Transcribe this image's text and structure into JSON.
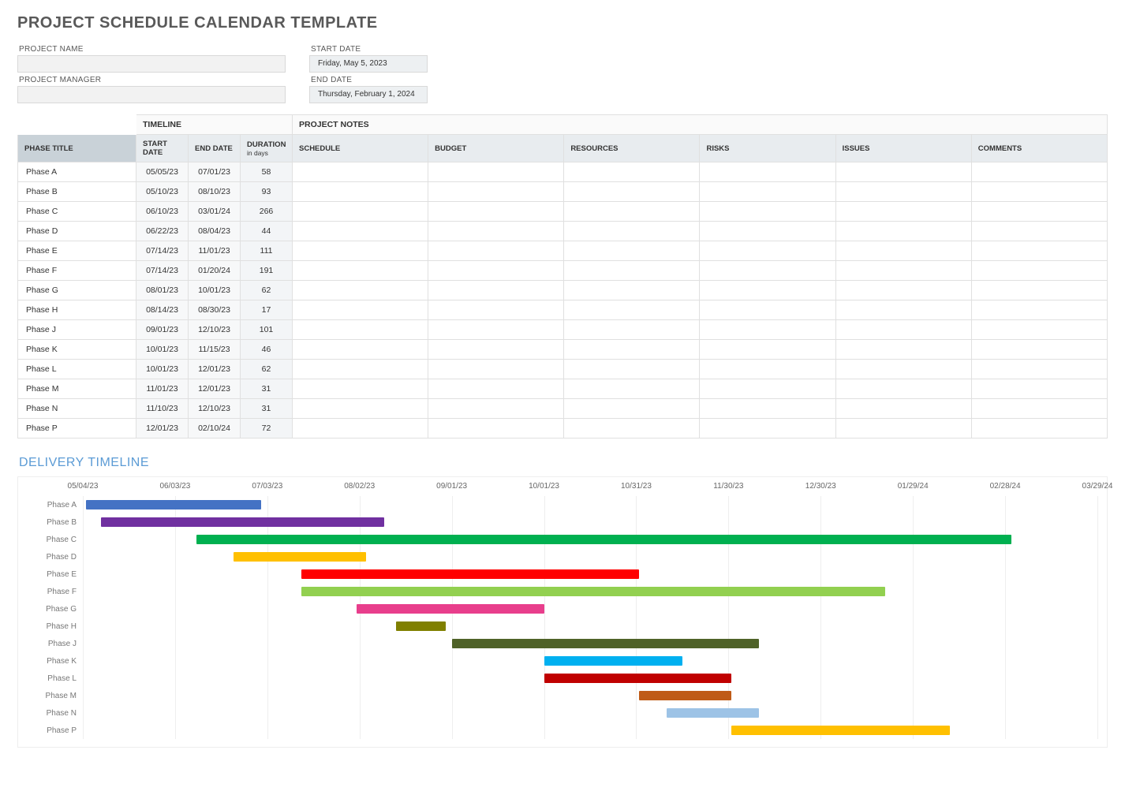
{
  "title": "PROJECT SCHEDULE CALENDAR TEMPLATE",
  "meta": {
    "project_name_label": "PROJECT NAME",
    "project_name_value": "",
    "project_manager_label": "PROJECT MANAGER",
    "project_manager_value": "",
    "start_date_label": "START DATE",
    "start_date_value": "Friday, May 5, 2023",
    "end_date_label": "END DATE",
    "end_date_value": "Thursday, February 1, 2024"
  },
  "table": {
    "group_timeline": "TIMELINE",
    "group_notes": "PROJECT NOTES",
    "headers": {
      "phase": "PHASE TITLE",
      "start": "START DATE",
      "end": "END DATE",
      "duration": "DURATION",
      "duration_sub": "in days",
      "schedule": "SCHEDULE",
      "budget": "BUDGET",
      "resources": "RESOURCES",
      "risks": "RISKS",
      "issues": "ISSUES",
      "comments": "COMMENTS"
    },
    "rows": [
      {
        "phase": "Phase A",
        "start": "05/05/23",
        "end": "07/01/23",
        "duration": "58",
        "schedule": "",
        "budget": "",
        "resources": "",
        "risks": "",
        "issues": "",
        "comments": ""
      },
      {
        "phase": "Phase B",
        "start": "05/10/23",
        "end": "08/10/23",
        "duration": "93",
        "schedule": "",
        "budget": "",
        "resources": "",
        "risks": "",
        "issues": "",
        "comments": ""
      },
      {
        "phase": "Phase C",
        "start": "06/10/23",
        "end": "03/01/24",
        "duration": "266",
        "schedule": "",
        "budget": "",
        "resources": "",
        "risks": "",
        "issues": "",
        "comments": ""
      },
      {
        "phase": "Phase D",
        "start": "06/22/23",
        "end": "08/04/23",
        "duration": "44",
        "schedule": "",
        "budget": "",
        "resources": "",
        "risks": "",
        "issues": "",
        "comments": ""
      },
      {
        "phase": "Phase E",
        "start": "07/14/23",
        "end": "11/01/23",
        "duration": "111",
        "schedule": "",
        "budget": "",
        "resources": "",
        "risks": "",
        "issues": "",
        "comments": ""
      },
      {
        "phase": "Phase F",
        "start": "07/14/23",
        "end": "01/20/24",
        "duration": "191",
        "schedule": "",
        "budget": "",
        "resources": "",
        "risks": "",
        "issues": "",
        "comments": ""
      },
      {
        "phase": "Phase G",
        "start": "08/01/23",
        "end": "10/01/23",
        "duration": "62",
        "schedule": "",
        "budget": "",
        "resources": "",
        "risks": "",
        "issues": "",
        "comments": ""
      },
      {
        "phase": "Phase H",
        "start": "08/14/23",
        "end": "08/30/23",
        "duration": "17",
        "schedule": "",
        "budget": "",
        "resources": "",
        "risks": "",
        "issues": "",
        "comments": ""
      },
      {
        "phase": "Phase J",
        "start": "09/01/23",
        "end": "12/10/23",
        "duration": "101",
        "schedule": "",
        "budget": "",
        "resources": "",
        "risks": "",
        "issues": "",
        "comments": ""
      },
      {
        "phase": "Phase K",
        "start": "10/01/23",
        "end": "11/15/23",
        "duration": "46",
        "schedule": "",
        "budget": "",
        "resources": "",
        "risks": "",
        "issues": "",
        "comments": ""
      },
      {
        "phase": "Phase L",
        "start": "10/01/23",
        "end": "12/01/23",
        "duration": "62",
        "schedule": "",
        "budget": "",
        "resources": "",
        "risks": "",
        "issues": "",
        "comments": ""
      },
      {
        "phase": "Phase M",
        "start": "11/01/23",
        "end": "12/01/23",
        "duration": "31",
        "schedule": "",
        "budget": "",
        "resources": "",
        "risks": "",
        "issues": "",
        "comments": ""
      },
      {
        "phase": "Phase N",
        "start": "11/10/23",
        "end": "12/10/23",
        "duration": "31",
        "schedule": "",
        "budget": "",
        "resources": "",
        "risks": "",
        "issues": "",
        "comments": ""
      },
      {
        "phase": "Phase P",
        "start": "12/01/23",
        "end": "02/10/24",
        "duration": "72",
        "schedule": "",
        "budget": "",
        "resources": "",
        "risks": "",
        "issues": "",
        "comments": ""
      }
    ]
  },
  "delivery_title": "DELIVERY TIMELINE",
  "chart_data": {
    "type": "bar",
    "title": "DELIVERY TIMELINE",
    "xlabel": "",
    "ylabel": "",
    "x_axis_ticks": [
      "05/04/23",
      "06/03/23",
      "07/03/23",
      "08/02/23",
      "09/01/23",
      "10/01/23",
      "10/31/23",
      "11/30/23",
      "12/30/23",
      "01/29/24",
      "02/28/24",
      "03/29/24"
    ],
    "x_range": [
      "05/04/23",
      "03/29/24"
    ],
    "series": [
      {
        "name": "Phase A",
        "start": "05/05/23",
        "end": "07/01/23",
        "duration_days": 58,
        "color": "#4472c4"
      },
      {
        "name": "Phase B",
        "start": "05/10/23",
        "end": "08/10/23",
        "duration_days": 93,
        "color": "#7030a0"
      },
      {
        "name": "Phase C",
        "start": "06/10/23",
        "end": "03/01/24",
        "duration_days": 266,
        "color": "#00b050"
      },
      {
        "name": "Phase D",
        "start": "06/22/23",
        "end": "08/04/23",
        "duration_days": 44,
        "color": "#ffc000"
      },
      {
        "name": "Phase E",
        "start": "07/14/23",
        "end": "11/01/23",
        "duration_days": 111,
        "color": "#ff0000"
      },
      {
        "name": "Phase F",
        "start": "07/14/23",
        "end": "01/20/24",
        "duration_days": 191,
        "color": "#92d050"
      },
      {
        "name": "Phase G",
        "start": "08/01/23",
        "end": "10/01/23",
        "duration_days": 62,
        "color": "#e83e8c"
      },
      {
        "name": "Phase H",
        "start": "08/14/23",
        "end": "08/30/23",
        "duration_days": 17,
        "color": "#808000"
      },
      {
        "name": "Phase J",
        "start": "09/01/23",
        "end": "12/10/23",
        "duration_days": 101,
        "color": "#4f6228"
      },
      {
        "name": "Phase K",
        "start": "10/01/23",
        "end": "11/15/23",
        "duration_days": 46,
        "color": "#00b0f0"
      },
      {
        "name": "Phase L",
        "start": "10/01/23",
        "end": "12/01/23",
        "duration_days": 62,
        "color": "#c00000"
      },
      {
        "name": "Phase M",
        "start": "11/01/23",
        "end": "12/01/23",
        "duration_days": 31,
        "color": "#bf5b17"
      },
      {
        "name": "Phase N",
        "start": "11/10/23",
        "end": "12/10/23",
        "duration_days": 31,
        "color": "#9dc3e6"
      },
      {
        "name": "Phase P",
        "start": "12/01/23",
        "end": "02/10/24",
        "duration_days": 72,
        "color": "#ffc000"
      }
    ]
  }
}
